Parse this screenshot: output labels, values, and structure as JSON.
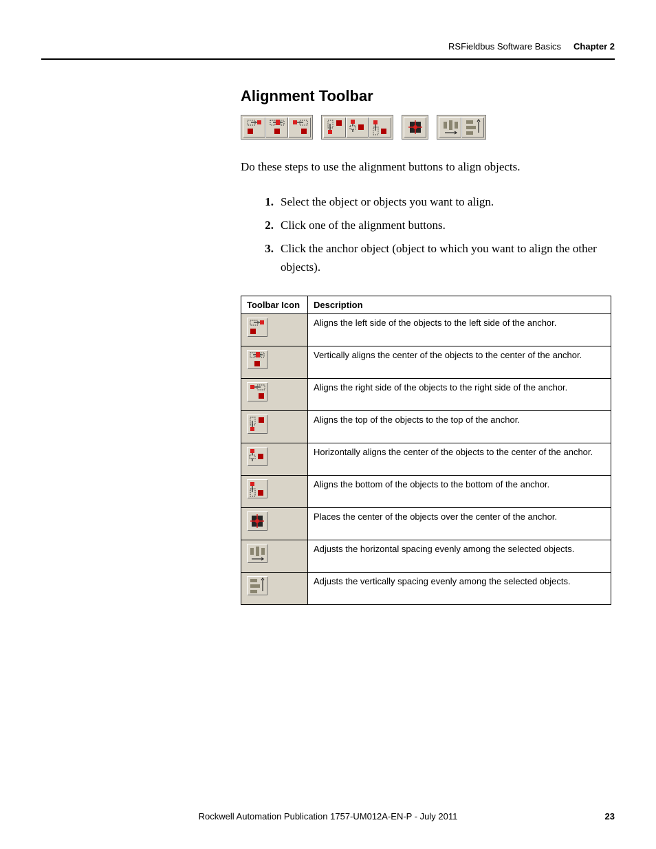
{
  "header": {
    "breadcrumb": "RSFieldbus Software Basics",
    "chapter": "Chapter 2"
  },
  "section_title": "Alignment Toolbar",
  "toolbar_groups": [
    [
      "align-left",
      "align-center-v",
      "align-right"
    ],
    [
      "align-top",
      "align-center-h",
      "align-bottom"
    ],
    [
      "align-center-both"
    ],
    [
      "space-horizontal",
      "space-vertical"
    ]
  ],
  "intro": "Do these steps to use the alignment buttons to align objects.",
  "steps": [
    {
      "num": "1.",
      "text": "Select the object or objects you want to align."
    },
    {
      "num": "2.",
      "text": "Click one of the alignment buttons."
    },
    {
      "num": "3.",
      "text": "Click the anchor object (object to which you want to align the other objects)."
    }
  ],
  "table": {
    "headers": {
      "icon": "Toolbar Icon",
      "desc": "Description"
    },
    "rows": [
      {
        "icon": "align-left",
        "desc": "Aligns the left side of the objects to the left side of the anchor."
      },
      {
        "icon": "align-center-v",
        "desc": "Vertically aligns the center of the objects to the center of the anchor."
      },
      {
        "icon": "align-right",
        "desc": "Aligns the right side of the objects to the right side of the anchor."
      },
      {
        "icon": "align-top",
        "desc": "Aligns the top of the objects to the top of the anchor."
      },
      {
        "icon": "align-center-h",
        "desc": "Horizontally aligns the center of the objects to the center of the anchor."
      },
      {
        "icon": "align-bottom",
        "desc": "Aligns the bottom of the objects to the bottom of the anchor."
      },
      {
        "icon": "align-center-both",
        "desc": "Places the center of the objects over the center of the anchor."
      },
      {
        "icon": "space-horizontal",
        "desc": "Adjusts the horizontal spacing evenly among the selected objects."
      },
      {
        "icon": "space-vertical",
        "desc": "Adjusts the vertically spacing evenly among the selected objects."
      }
    ]
  },
  "footer": {
    "text": "Rockwell Automation Publication 1757-UM012A-EN-P - July 2011",
    "page": "23"
  }
}
